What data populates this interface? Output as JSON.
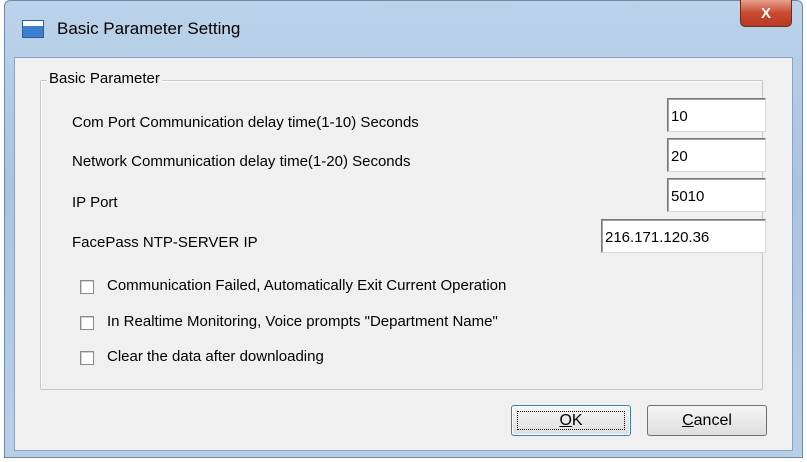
{
  "window": {
    "title": "Basic Parameter Setting",
    "close_glyph": "X"
  },
  "group": {
    "title": "Basic Parameter"
  },
  "fields": [
    {
      "label": "Com Port Communication delay time(1-10) Seconds",
      "value": "10"
    },
    {
      "label": "Network Communication delay time(1-20) Seconds",
      "value": "20"
    },
    {
      "label": "IP Port",
      "value": "5010"
    },
    {
      "label": "FacePass NTP-SERVER IP",
      "value": "216.171.120.36"
    }
  ],
  "checkboxes": [
    {
      "label": "Communication Failed, Automatically Exit Current Operation",
      "checked": false
    },
    {
      "label": "In Realtime Monitoring, Voice prompts \"Department Name\"",
      "checked": false
    },
    {
      "label": "Clear the data after downloading",
      "checked": false
    }
  ],
  "buttons": {
    "ok_mnemonic": "O",
    "ok_rest": "K",
    "cancel_mnemonic": "C",
    "cancel_rest": "ancel"
  }
}
